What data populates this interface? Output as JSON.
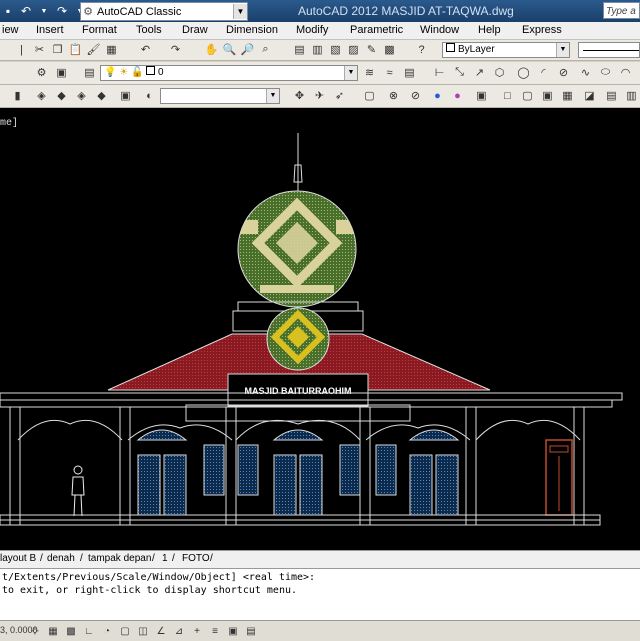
{
  "title_bar": {
    "workspace": "AutoCAD Classic",
    "app_title": "AutoCAD 2012   MASJID AT-TAQWA.dwg",
    "search_placeholder": "Type a keyword"
  },
  "menu": [
    "iew",
    "Insert",
    "Format",
    "Tools",
    "Draw",
    "Dimension",
    "Modify",
    "Parametric",
    "Window",
    "Help",
    "Express"
  ],
  "properties": {
    "color_control": "ByLayer",
    "layer_value": "0"
  },
  "viewport_label": "me]",
  "drawing": {
    "sign_text": "MASJID BAITURRAOHIM",
    "colors": {
      "roof": "#8a1a22",
      "dome_pattern": "#4a7a2a",
      "dome_cream": "#d9d29c",
      "dome_gold": "#d8c020",
      "lines": "#ffffff",
      "windows": "#2f6fb0",
      "door": "#c04a2a"
    }
  },
  "layout_tabs": [
    "layout B",
    "denah",
    "tampak depan",
    "1",
    "FOTO"
  ],
  "command": {
    "line1": "t/Extents/Previous/Scale/Window/Object] <real time>:",
    "line2": " to exit, or right-click to display shortcut menu."
  },
  "status": {
    "coord": "3, 0.0000"
  }
}
